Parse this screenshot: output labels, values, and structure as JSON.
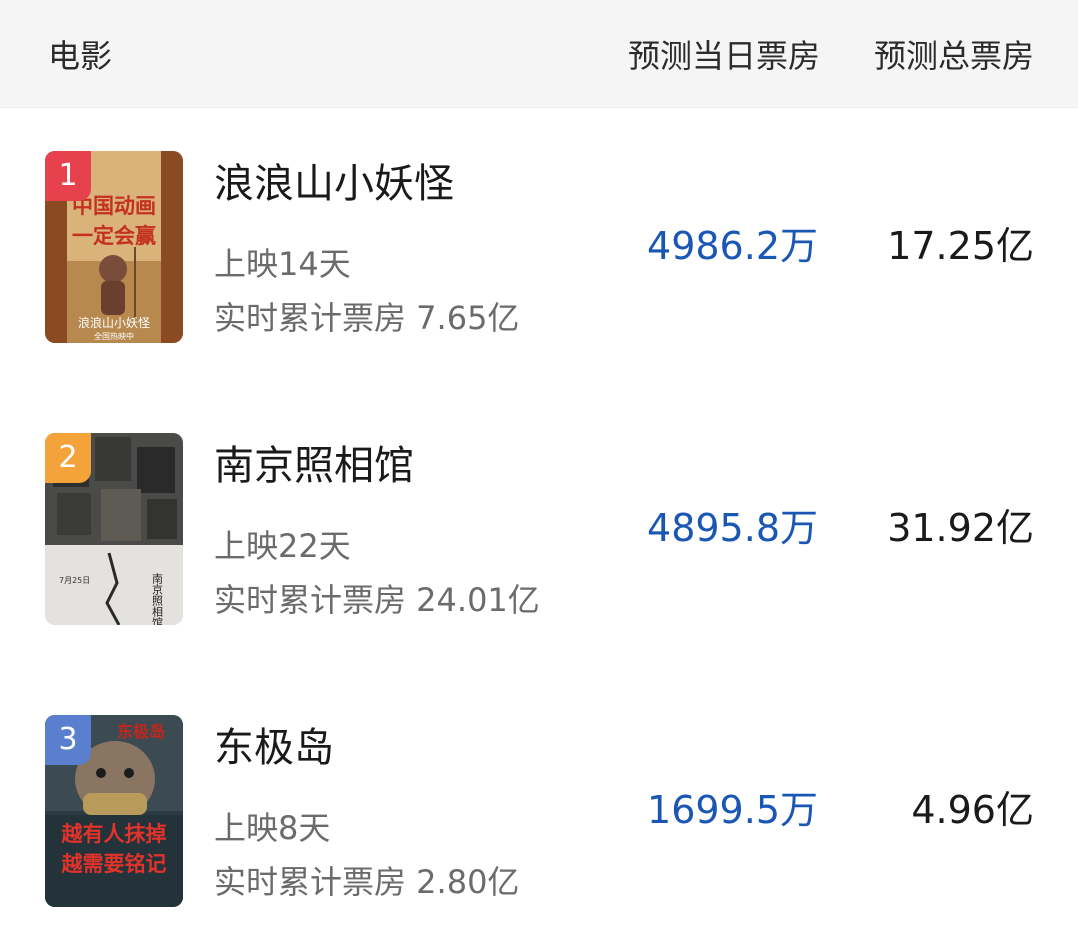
{
  "header": {
    "movie_label": "电影",
    "day_forecast_label": "预测当日票房",
    "total_forecast_label": "预测总票房"
  },
  "movies": [
    {
      "rank": "1",
      "title": "浪浪山小妖怪",
      "days_showing": "上映14天",
      "cumulative_box_office": "实时累计票房 7.65亿",
      "day_forecast": "4986.2万",
      "total_forecast": "17.25亿",
      "poster_text_line1": "中国动画",
      "poster_text_line2": "一定会赢",
      "poster_text_line3": "浪浪山小妖怪",
      "poster_text_line4": "全国热映中"
    },
    {
      "rank": "2",
      "title": "南京照相馆",
      "days_showing": "上映22天",
      "cumulative_box_office": "实时累计票房 24.01亿",
      "day_forecast": "4895.8万",
      "total_forecast": "31.92亿",
      "poster_text_line1": "南京照相馆",
      "poster_text_line2": "7月25日"
    },
    {
      "rank": "3",
      "title": "东极岛",
      "days_showing": "上映8天",
      "cumulative_box_office": "实时累计票房 2.80亿",
      "day_forecast": "1699.5万",
      "total_forecast": "4.96亿",
      "poster_text_line1": "东极岛",
      "poster_text_line2": "越有人抹掉",
      "poster_text_line3": "越需要铭记"
    }
  ]
}
